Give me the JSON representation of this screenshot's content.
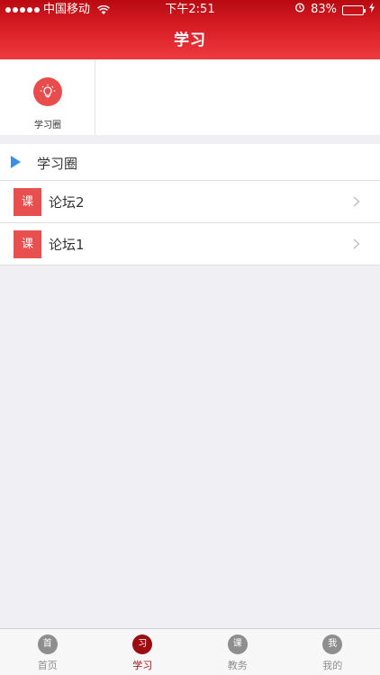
{
  "status_bar": {
    "carrier": "中国移动",
    "time": "下午2:51",
    "battery": "83%",
    "battery_level": 0.83
  },
  "header": {
    "title": "学习"
  },
  "grid": {
    "items": [
      {
        "label": "学习圈",
        "icon": "lightbulb-icon"
      }
    ]
  },
  "section": {
    "title": "学习圈"
  },
  "list": {
    "items": [
      {
        "badge": "课",
        "label": "论坛2"
      },
      {
        "badge": "课",
        "label": "论坛1"
      }
    ]
  },
  "tabs": [
    {
      "icon_text": "首",
      "label": "首页"
    },
    {
      "icon_text": "习",
      "label": "学习"
    },
    {
      "icon_text": "课",
      "label": "教务"
    },
    {
      "icon_text": "我",
      "label": "我的"
    }
  ],
  "colors": {
    "header_red": "#d81d24",
    "active_tab": "#9c0d12",
    "badge_red": "#e8504f",
    "section_marker": "#3a8ee6"
  }
}
